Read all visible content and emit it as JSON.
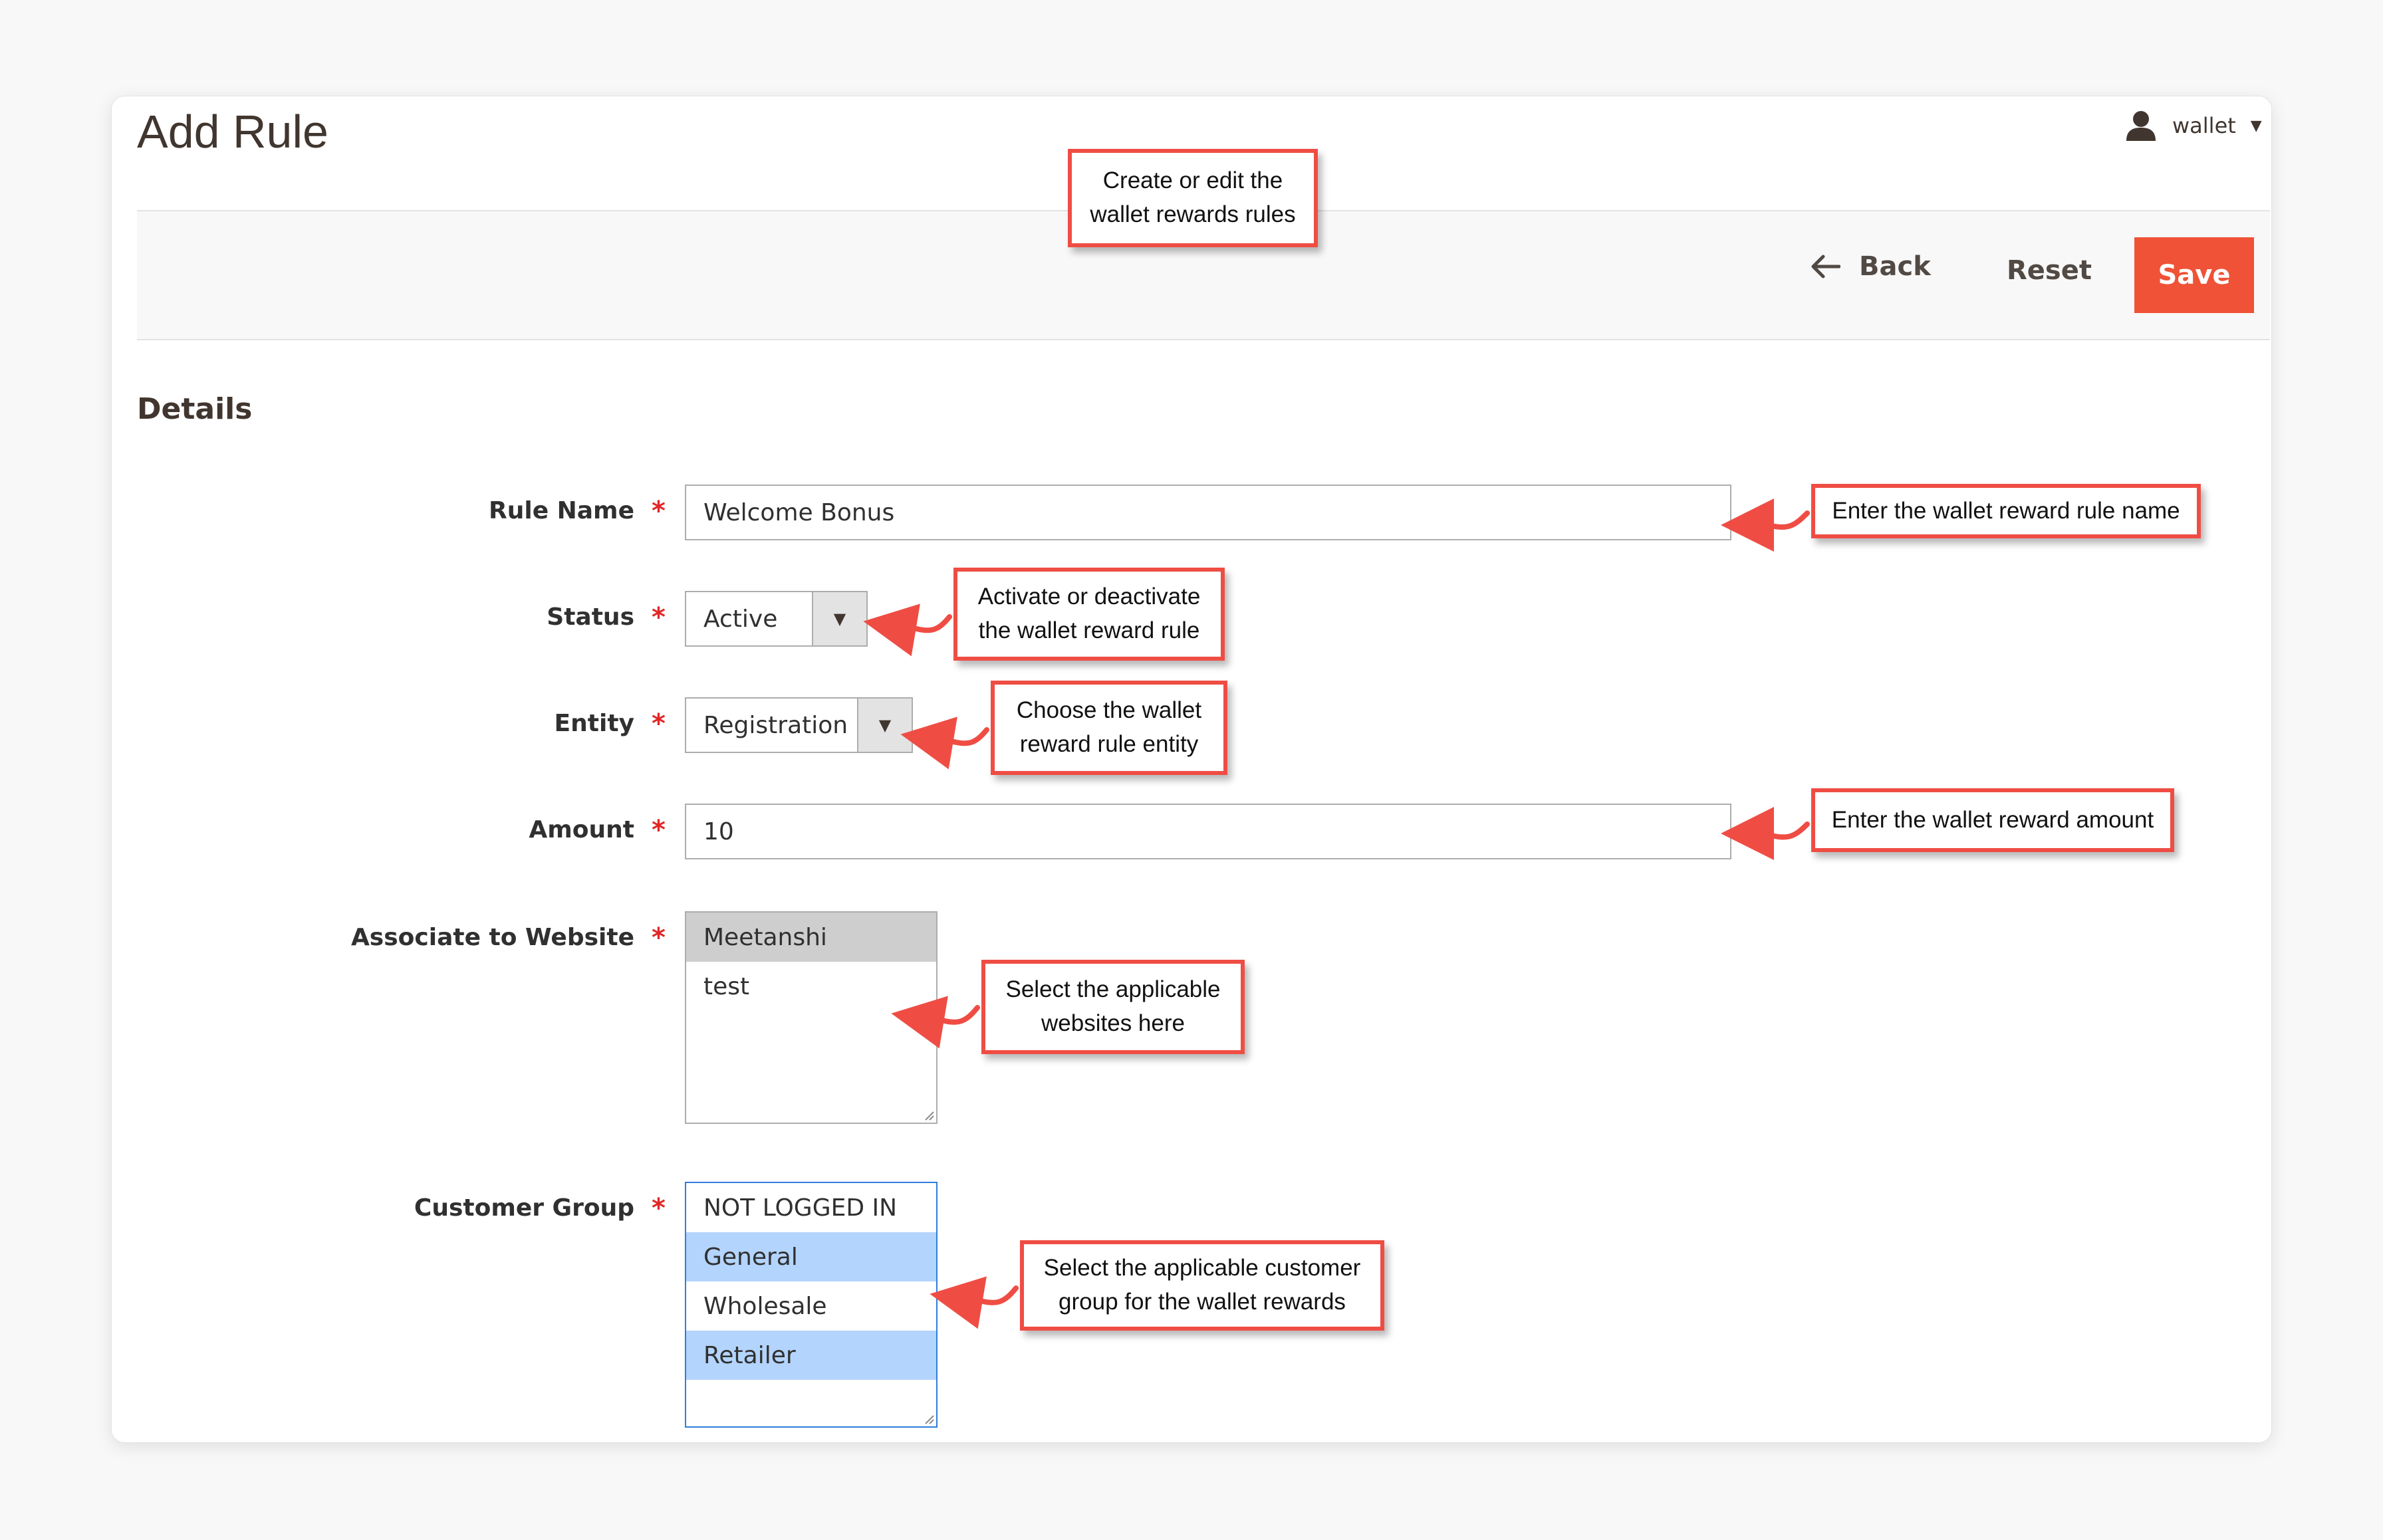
{
  "header": {
    "title": "Add Rule",
    "user_name": "wallet"
  },
  "actions": {
    "back_label": "Back",
    "reset_label": "Reset",
    "save_label": "Save"
  },
  "section": {
    "title": "Details"
  },
  "form": {
    "rule_name": {
      "label": "Rule Name",
      "required": "*",
      "value": "Welcome Bonus"
    },
    "status": {
      "label": "Status",
      "required": "*",
      "value": "Active"
    },
    "entity": {
      "label": "Entity",
      "required": "*",
      "value": "Registration"
    },
    "amount": {
      "label": "Amount",
      "required": "*",
      "value": "10"
    },
    "website": {
      "label": "Associate to Website",
      "required": "*",
      "options": [
        "Meetanshi",
        "test"
      ]
    },
    "customer_group": {
      "label": "Customer Group",
      "required": "*",
      "options": [
        "NOT LOGGED IN",
        "General",
        "Wholesale",
        "Retailer"
      ]
    }
  },
  "callouts": {
    "title_note": [
      "Create or edit the",
      "wallet rewards rules"
    ],
    "rule_name_note": [
      "Enter the wallet reward rule name"
    ],
    "status_note": [
      "Activate or deactivate",
      "the wallet reward rule"
    ],
    "entity_note": [
      "Choose the wallet",
      "reward rule entity"
    ],
    "amount_note": [
      "Enter the wallet reward amount"
    ],
    "website_note": [
      "Select the applicable",
      "websites here"
    ],
    "group_note": [
      "Select the applicable customer",
      "group for the wallet rewards"
    ]
  },
  "colors": {
    "save_button": "#ef5236",
    "callout_border": "#ef4d44",
    "required_star": "#e22626",
    "selected_option": "#b3d4fc"
  }
}
